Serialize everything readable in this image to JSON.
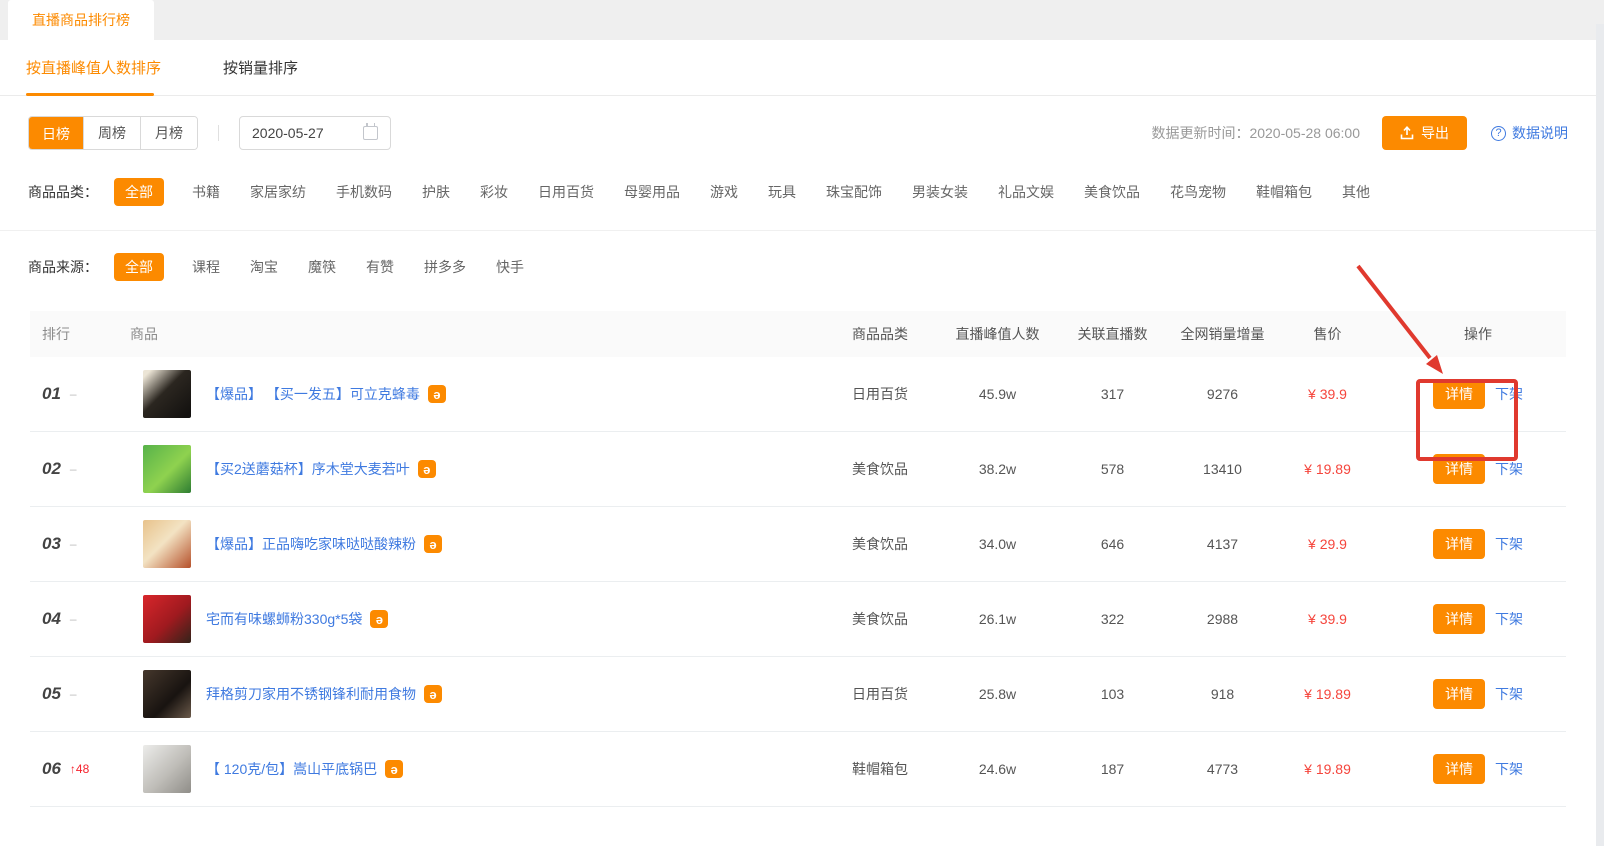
{
  "colors": {
    "accent": "#fc8a00",
    "price": "#f5453c",
    "link_blue": "#3f7ae0",
    "annotation_red": "#e0392e"
  },
  "tabbar": {
    "active_tab": "直播商品排行榜"
  },
  "subtabs": {
    "peak": "按直播峰值人数排序",
    "sales": "按销量排序"
  },
  "toolbar": {
    "periods": {
      "day": "日榜",
      "week": "周榜",
      "month": "月榜"
    },
    "date": "2020-05-27",
    "update_label": "数据更新时间：",
    "update_time": "2020-05-28 06:00",
    "export": "导出",
    "data_info": "数据说明"
  },
  "category_filter": {
    "label": "商品品类：",
    "active": "全部",
    "options": [
      "书籍",
      "家居家纺",
      "手机数码",
      "护肤",
      "彩妆",
      "日用百货",
      "母婴用品",
      "游戏",
      "玩具",
      "珠宝配饰",
      "男装女装",
      "礼品文娱",
      "美食饮品",
      "花鸟宠物",
      "鞋帽箱包",
      "其他"
    ]
  },
  "source_filter": {
    "label": "商品来源：",
    "active": "全部",
    "options": [
      "课程",
      "淘宝",
      "魔筷",
      "有赞",
      "拼多多",
      "快手"
    ]
  },
  "table": {
    "headers": [
      "排行",
      "商品",
      "商品品类",
      "直播峰值人数",
      "关联直播数",
      "全网销量增量",
      "售价",
      "操作"
    ],
    "detail_label": "详情",
    "offshelf_label": "下架",
    "badge_glyph": "ə",
    "rows": [
      {
        "rank": "01",
        "change": "–",
        "title": "【爆品】 【买一发五】可立克蜂毒",
        "category": "日用百货",
        "peak": "45.9w",
        "live_count": "317",
        "sales_growth": "9276",
        "price": "¥ 39.9"
      },
      {
        "rank": "02",
        "change": "–",
        "title": "【买2送蘑菇杯】序木堂大麦若叶",
        "category": "美食饮品",
        "peak": "38.2w",
        "live_count": "578",
        "sales_growth": "13410",
        "price": "¥ 19.89"
      },
      {
        "rank": "03",
        "change": "–",
        "title": "【爆品】正品嗨吃家味哒哒酸辣粉",
        "category": "美食饮品",
        "peak": "34.0w",
        "live_count": "646",
        "sales_growth": "4137",
        "price": "¥ 29.9"
      },
      {
        "rank": "04",
        "change": "–",
        "title": "宅而有味螺蛳粉330g*5袋",
        "category": "美食饮品",
        "peak": "26.1w",
        "live_count": "322",
        "sales_growth": "2988",
        "price": "¥ 39.9"
      },
      {
        "rank": "05",
        "change": "–",
        "title": "拜格剪刀家用不锈钢锋利耐用食物",
        "category": "日用百货",
        "peak": "25.8w",
        "live_count": "103",
        "sales_growth": "918",
        "price": "¥ 19.89"
      },
      {
        "rank": "06",
        "change": "↑48",
        "title": "【 120克/包】嵩山平底锅巴",
        "category": "鞋帽箱包",
        "peak": "24.6w",
        "live_count": "187",
        "sales_growth": "4773",
        "price": "¥ 19.89"
      }
    ]
  }
}
